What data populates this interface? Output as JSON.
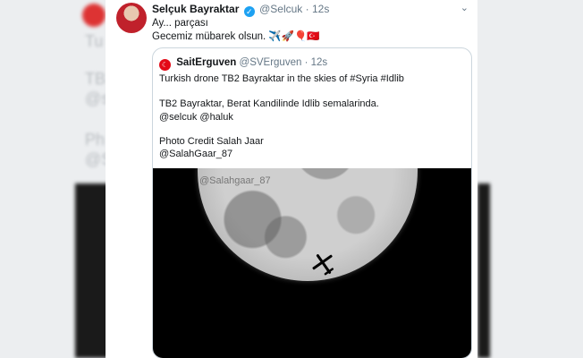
{
  "tweet": {
    "name": "Selçuk Bayraktar",
    "handle": "@Selcuk",
    "time": "12s",
    "line1": "Ay... parçası",
    "line2": "Gecemiz mübarek olsun.",
    "emojis": "✈️🚀🎈🇹🇷",
    "verified_icon": "✓"
  },
  "quoted": {
    "name": "SaitErguven",
    "handle": "@SVErguven",
    "time": "12s",
    "lines": [
      "Turkish drone TB2 Bayraktar in the skies of #Syria #Idlib",
      "TB2 Bayraktar, Berat Kandilinde Idlib semalarinda.",
      "@selcuk @haluk",
      "Photo Credit Salah Jaar",
      "@SalahGaar_87"
    ],
    "photo_watermark": "@Salahgaar_87",
    "flag_icon": "☾"
  },
  "colors": {
    "verified": "#1da1f2",
    "flag": "#e30a17",
    "text": "#14171a",
    "muted": "#657786"
  }
}
